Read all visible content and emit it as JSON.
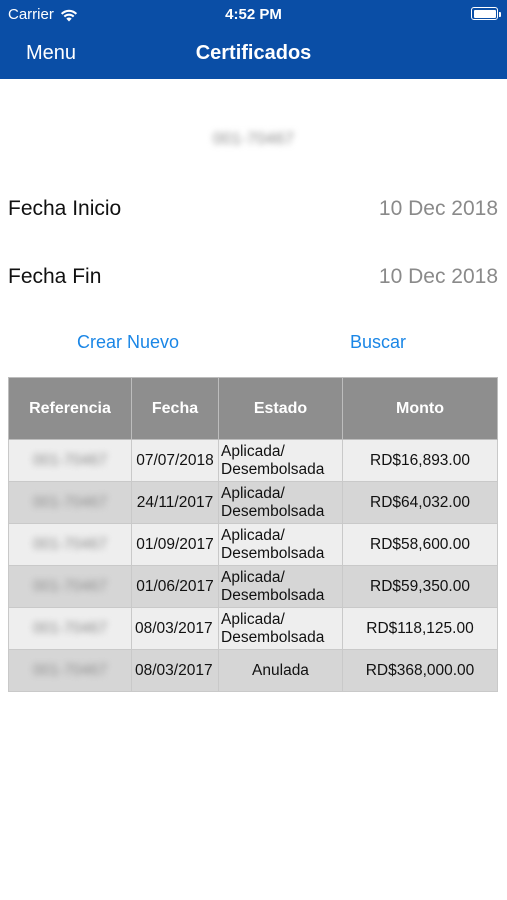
{
  "status_bar": {
    "carrier": "Carrier",
    "time": "4:52 PM"
  },
  "nav": {
    "menu_label": "Menu",
    "title": "Certificados"
  },
  "account_id": "001-70467",
  "fields": {
    "start_label": "Fecha Inicio",
    "start_value": "10 Dec 2018",
    "end_label": "Fecha Fin",
    "end_value": "10 Dec 2018"
  },
  "actions": {
    "create_label": "Crear Nuevo",
    "search_label": "Buscar"
  },
  "table": {
    "headers": [
      "Referencia",
      "Fecha",
      "Estado",
      "Monto"
    ],
    "rows": [
      {
        "ref": "001-70467",
        "fecha": "07/07/2018",
        "estado": "Aplicada/ Desembolsada",
        "monto": "RD$16,893.00"
      },
      {
        "ref": "001-70467",
        "fecha": "24/11/2017",
        "estado": "Aplicada/ Desembolsada",
        "monto": "RD$64,032.00"
      },
      {
        "ref": "001-70467",
        "fecha": "01/09/2017",
        "estado": "Aplicada/ Desembolsada",
        "monto": "RD$58,600.00"
      },
      {
        "ref": "001-70467",
        "fecha": "01/06/2017",
        "estado": "Aplicada/ Desembolsada",
        "monto": "RD$59,350.00"
      },
      {
        "ref": "001-70467",
        "fecha": "08/03/2017",
        "estado": "Aplicada/ Desembolsada",
        "monto": "RD$118,125.00"
      },
      {
        "ref": "001-70467",
        "fecha": "08/03/2017",
        "estado": "Anulada",
        "monto": "RD$368,000.00"
      }
    ]
  },
  "colors": {
    "header_bg": "#0a4ea6",
    "link": "#1a86e6",
    "table_header_bg": "#8e8e8e"
  }
}
